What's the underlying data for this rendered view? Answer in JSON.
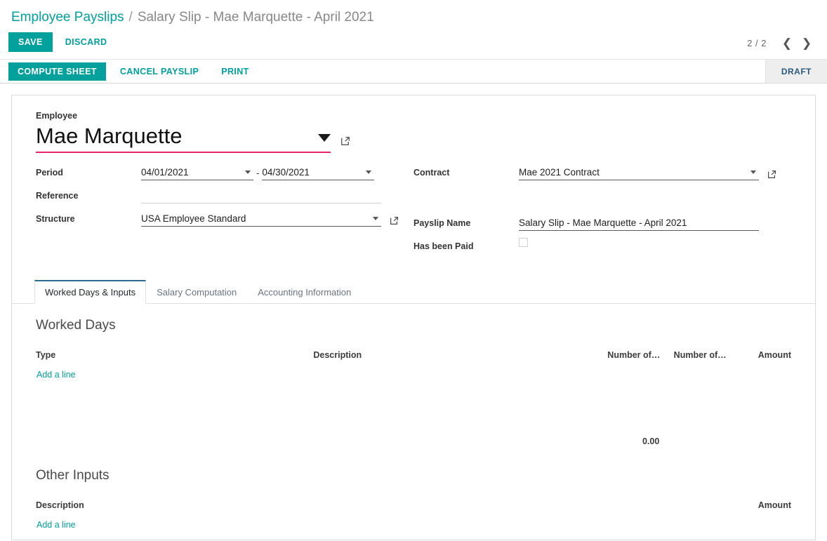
{
  "breadcrumb": {
    "root": "Employee Payslips",
    "separator": "/",
    "current": "Salary Slip - Mae Marquette - April 2021"
  },
  "controls": {
    "save_label": "SAVE",
    "discard_label": "DISCARD",
    "pager_count": "2 / 2",
    "prev_icon": "chevron-left",
    "next_icon": "chevron-right"
  },
  "action_bar": {
    "compute_sheet_label": "COMPUTE SHEET",
    "cancel_payslip_label": "CANCEL PAYSLIP",
    "print_label": "PRINT",
    "status": "DRAFT"
  },
  "form": {
    "employee_label": "Employee",
    "employee_value": "Mae Marquette",
    "period_label": "Period",
    "period_from": "04/01/2021",
    "period_dash": "-",
    "period_to": "04/30/2021",
    "reference_label": "Reference",
    "reference_value": "",
    "structure_label": "Structure",
    "structure_value": "USA Employee Standard",
    "contract_label": "Contract",
    "contract_value": "Mae 2021 Contract",
    "payslip_name_label": "Payslip Name",
    "payslip_name_value": "Salary Slip - Mae Marquette - April 2021",
    "has_been_paid_label": "Has been Paid",
    "has_been_paid_checked": false
  },
  "tabs": [
    {
      "label": "Worked Days & Inputs",
      "active": true
    },
    {
      "label": "Salary Computation",
      "active": false
    },
    {
      "label": "Accounting Information",
      "active": false
    }
  ],
  "worked_days": {
    "section_title": "Worked Days",
    "columns": {
      "type": "Type",
      "description": "Description",
      "number_of_1": "Number of…",
      "number_of_2": "Number of…",
      "amount": "Amount"
    },
    "add_line": "Add a line",
    "total_amount": "0.00",
    "rows": []
  },
  "other_inputs": {
    "section_title": "Other Inputs",
    "columns": {
      "description": "Description",
      "amount": "Amount"
    },
    "add_line": "Add a line",
    "rows": []
  },
  "colors": {
    "accent_teal": "#00A09D",
    "focus_pink": "#e6256e",
    "status_text": "#2a5a7a",
    "tab_active_border": "#2a6a8f"
  }
}
